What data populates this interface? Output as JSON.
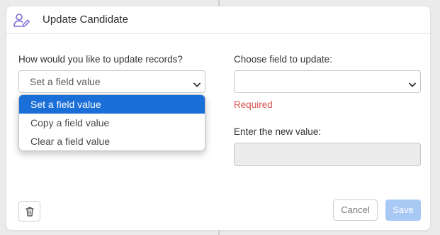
{
  "header": {
    "title": "Update Candidate",
    "icon": "user-edit-icon",
    "icon_color": "#7b6fd6"
  },
  "left": {
    "label": "How would you like to update records?",
    "select_value": "Set a field value",
    "options": [
      "Set a field value",
      "Copy a field value",
      "Clear a field value"
    ],
    "selected_option_color": "#1a6ed8"
  },
  "right": {
    "field_label": "Choose field to update:",
    "field_value": "",
    "required_text": "Required",
    "required_color": "#d9534f",
    "new_value_label": "Enter the new value:",
    "new_value": ""
  },
  "footer": {
    "delete_icon": "trash-icon",
    "cancel_label": "Cancel",
    "save_label": "Save",
    "save_color": "#a9c9f5"
  }
}
